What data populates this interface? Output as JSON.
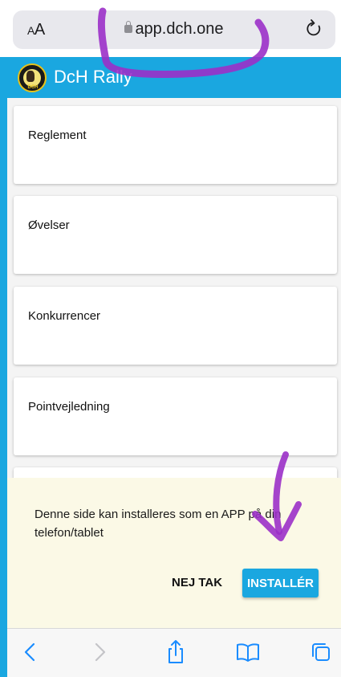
{
  "browser": {
    "text_size_label": "AA",
    "url": "app.dch.one"
  },
  "app": {
    "title": "DcH Rally",
    "logo_text": "DCH"
  },
  "menu": {
    "items": [
      {
        "label": "Reglement"
      },
      {
        "label": "Øvelser"
      },
      {
        "label": "Konkurrencer"
      },
      {
        "label": "Pointvejledning"
      },
      {
        "label": ""
      }
    ]
  },
  "install_prompt": {
    "message": "Denne side kan installeres som en APP på din telefon/tablet",
    "decline_label": "NEJ TAK",
    "install_label": "INSTALLÉR"
  },
  "toolbar": {
    "icons": [
      "back-icon",
      "forward-icon",
      "share-icon",
      "bookmarks-icon",
      "tabs-icon"
    ]
  },
  "colors": {
    "accent": "#1aa7e0",
    "prompt_bg": "#fbf9e6",
    "annotation": "#9b30c8"
  }
}
